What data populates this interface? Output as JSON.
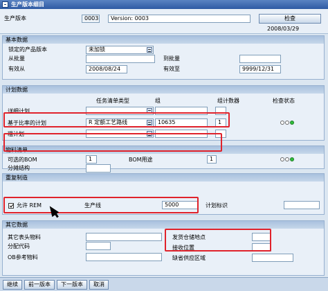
{
  "window": {
    "title": "生产版本细目"
  },
  "header": {
    "label": "生产版本",
    "version_no": "0003",
    "version_text": "Version: 0003",
    "check_button": "检查",
    "date": "2008/03/29"
  },
  "basic": {
    "title": "基本数据",
    "locked_label": "锁定的产品版本",
    "locked_value": "未加锁",
    "from_lot_label": "从批量",
    "from_lot_value": "",
    "to_lot_label": "到批量",
    "to_lot_value": "",
    "valid_from_label": "有效从",
    "valid_from_value": "2008/08/24",
    "valid_to_label": "有效至",
    "valid_to_value": "9999/12/31"
  },
  "planning": {
    "title": "计划数据",
    "col_tasklist_type": "任务清单类型",
    "col_group": "组",
    "col_group_counter": "组计数器",
    "col_check_status": "检查状态",
    "rows": [
      {
        "label": "详细计划",
        "type": "",
        "group": "",
        "counter": ""
      },
      {
        "label": "基于比率的计划",
        "type": "R 定额工艺路线",
        "group": "10635",
        "counter": "1"
      },
      {
        "label": "粗计划",
        "type": "",
        "group": "",
        "counter": ""
      }
    ]
  },
  "bom": {
    "title": "物料清单",
    "alt_bom_label": "可选的BOM",
    "alt_bom_value": "1",
    "bom_usage_label": "BOM用途",
    "bom_usage_value": "1",
    "apportion_label": "分摊结构",
    "apportion_value": ""
  },
  "rem": {
    "title": "重复制造",
    "allow_rem_label": "允许 REM",
    "production_line_label": "生产线",
    "production_line_value": "5000",
    "planning_id_label": "计划标识",
    "planning_id_value": ""
  },
  "other": {
    "title": "其它数据",
    "other_header_material_label": "其它表头物料",
    "other_header_material_value": "",
    "dist_key_label": "分配代码",
    "dist_key_value": "",
    "ob_ref_material_label": "OB参考物料",
    "ob_ref_material_value": "",
    "issue_storage_label": "发货仓储地点",
    "issue_storage_value": "",
    "receiving_storage_label": "接收位置",
    "receiving_storage_value": "",
    "default_supply_area_label": "缺省供应区域",
    "default_supply_area_value": ""
  },
  "footer": {
    "buttons": [
      "继续",
      "前一版本",
      "下一版本",
      "取消"
    ]
  },
  "colors": {
    "highlight": "#e0222b",
    "status_green": "#2fbf3a",
    "titlebar": "#2e5aa3"
  }
}
